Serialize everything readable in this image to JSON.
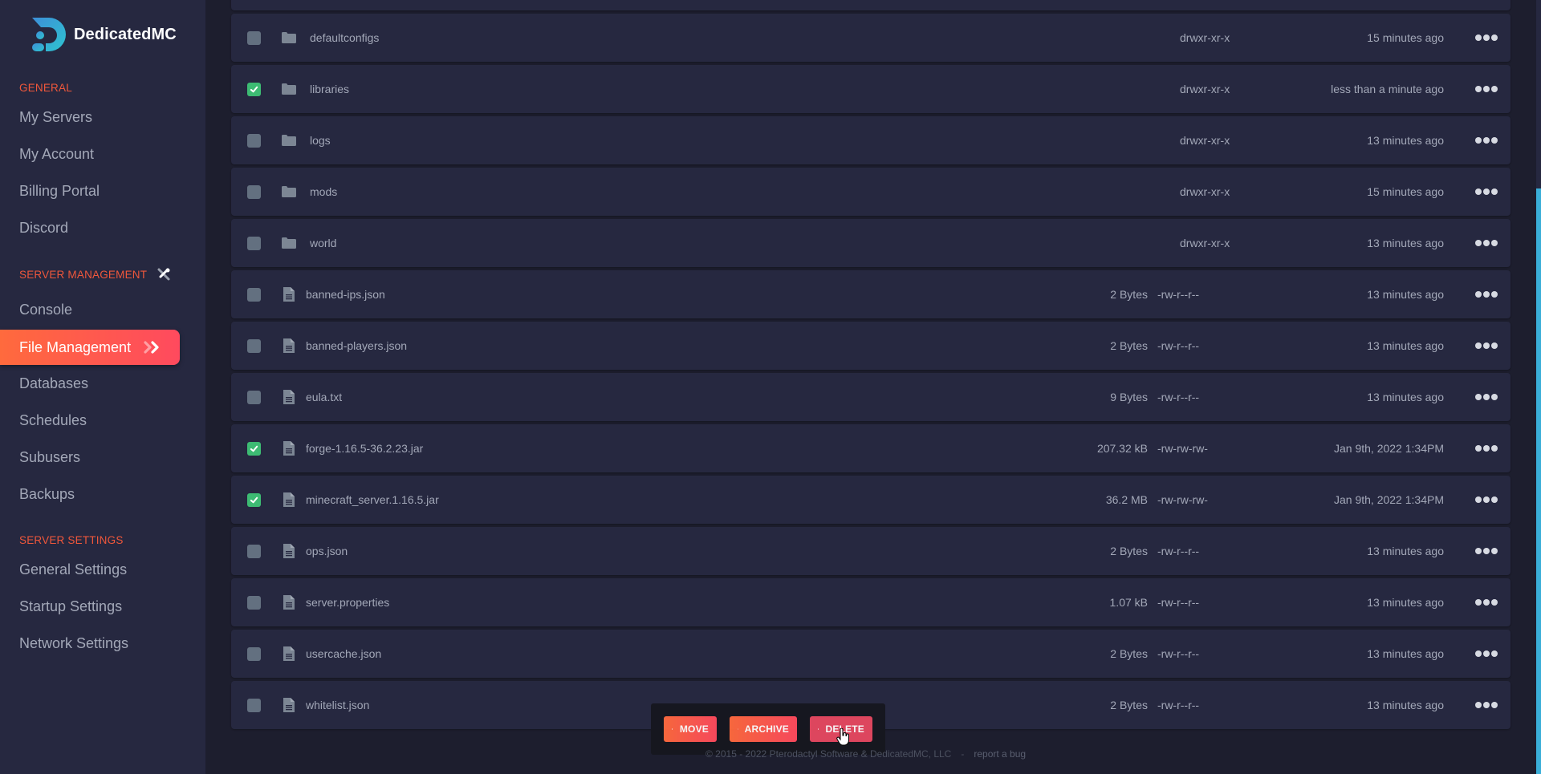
{
  "brand": {
    "name": "DedicatedMC",
    "accent": "#ff5a4a",
    "logo_color": "#3aaed8"
  },
  "sidebar": {
    "sections": [
      {
        "label": "GENERAL",
        "items": [
          "My Servers",
          "My Account",
          "Billing Portal",
          "Discord"
        ]
      },
      {
        "label": "SERVER MANAGEMENT",
        "icon": "tools-icon",
        "items": [
          "Console",
          "File Management",
          "Databases",
          "Schedules",
          "Subusers",
          "Backups"
        ]
      },
      {
        "label": "SERVER SETTINGS",
        "items": [
          "General Settings",
          "Startup Settings",
          "Network Settings"
        ]
      }
    ],
    "active_item": "File Management"
  },
  "files": [
    {
      "type": "folder",
      "name": "defaultconfigs",
      "size": "",
      "perms": "drwxr-xr-x",
      "modified": "15 minutes ago",
      "checked": false
    },
    {
      "type": "folder",
      "name": "libraries",
      "size": "",
      "perms": "drwxr-xr-x",
      "modified": "less than a minute ago",
      "checked": true
    },
    {
      "type": "folder",
      "name": "logs",
      "size": "",
      "perms": "drwxr-xr-x",
      "modified": "13 minutes ago",
      "checked": false
    },
    {
      "type": "folder",
      "name": "mods",
      "size": "",
      "perms": "drwxr-xr-x",
      "modified": "15 minutes ago",
      "checked": false
    },
    {
      "type": "folder",
      "name": "world",
      "size": "",
      "perms": "drwxr-xr-x",
      "modified": "13 minutes ago",
      "checked": false
    },
    {
      "type": "file",
      "name": "banned-ips.json",
      "size": "2 Bytes",
      "perms": "-rw-r--r--",
      "modified": "13 minutes ago",
      "checked": false
    },
    {
      "type": "file",
      "name": "banned-players.json",
      "size": "2 Bytes",
      "perms": "-rw-r--r--",
      "modified": "13 minutes ago",
      "checked": false
    },
    {
      "type": "file",
      "name": "eula.txt",
      "size": "9 Bytes",
      "perms": "-rw-r--r--",
      "modified": "13 minutes ago",
      "checked": false
    },
    {
      "type": "file",
      "name": "forge-1.16.5-36.2.23.jar",
      "size": "207.32 kB",
      "perms": "-rw-rw-rw-",
      "modified": "Jan 9th, 2022 1:34PM",
      "checked": true
    },
    {
      "type": "file",
      "name": "minecraft_server.1.16.5.jar",
      "size": "36.2 MB",
      "perms": "-rw-rw-rw-",
      "modified": "Jan 9th, 2022 1:34PM",
      "checked": true
    },
    {
      "type": "file",
      "name": "ops.json",
      "size": "2 Bytes",
      "perms": "-rw-r--r--",
      "modified": "13 minutes ago",
      "checked": false
    },
    {
      "type": "file",
      "name": "server.properties",
      "size": "1.07 kB",
      "perms": "-rw-r--r--",
      "modified": "13 minutes ago",
      "checked": false
    },
    {
      "type": "file",
      "name": "usercache.json",
      "size": "2 Bytes",
      "perms": "-rw-r--r--",
      "modified": "13 minutes ago",
      "checked": false
    },
    {
      "type": "file",
      "name": "whitelist.json",
      "size": "2 Bytes",
      "perms": "-rw-r--r--",
      "modified": "13 minutes ago",
      "checked": false
    }
  ],
  "actions": {
    "move": "MOVE",
    "archive": "ARCHIVE",
    "delete": "DELETE"
  },
  "footer": {
    "copyright": "© 2015 - 2022 Pterodactyl Software & DedicatedMC, LLC",
    "separator": "-",
    "report_link": "report a bug"
  }
}
